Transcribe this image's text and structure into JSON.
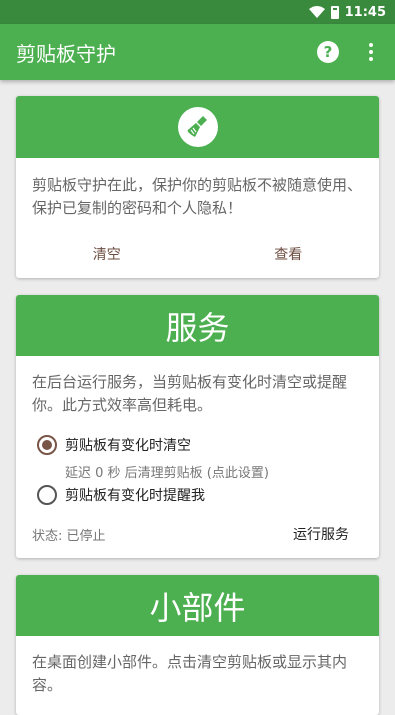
{
  "status_bar": {
    "time": "11:45"
  },
  "app_bar": {
    "title": "剪贴板守护",
    "help_label": "?"
  },
  "protect_card": {
    "description": "剪贴板守护在此，保护你的剪贴板不被随意使用、保护已复制的密码和个人隐私！",
    "clear_label": "清空",
    "view_label": "查看"
  },
  "service_card": {
    "title": "服务",
    "description": "在后台运行服务，当剪贴板有变化时清空或提醒你。此方式效率高但耗电。",
    "options": [
      {
        "label": "剪贴板有变化时清空",
        "selected": true,
        "sub": "延迟 0 秒 后清理剪贴板 (点此设置)"
      },
      {
        "label": "剪贴板有变化时提醒我",
        "selected": false
      }
    ],
    "status": "状态: 已停止",
    "run_label": "运行服务"
  },
  "widget_card": {
    "title": "小部件",
    "description": "在桌面创建小部件。点击清空剪贴板或显示其内容。"
  },
  "colors": {
    "primary": "#4caf50",
    "status_bar": "#3a8a3e",
    "accent": "#795548"
  }
}
